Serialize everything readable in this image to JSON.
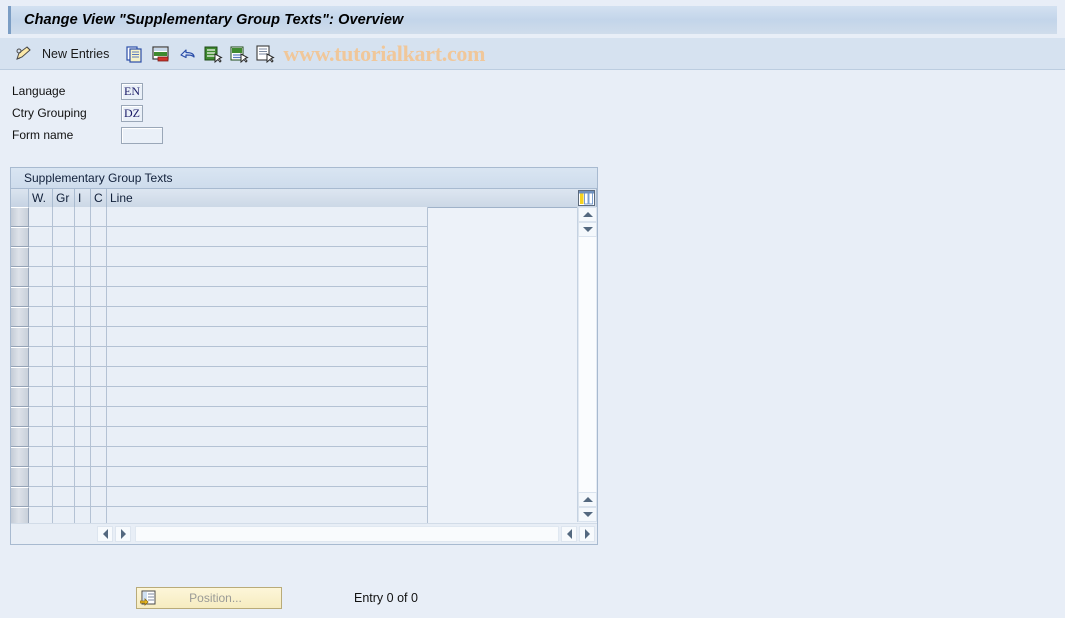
{
  "window": {
    "title": "Change View \"Supplementary Group Texts\": Overview"
  },
  "toolbar": {
    "change_icon": "pencil-icon",
    "new_entries_label": "New Entries",
    "icons": [
      {
        "name": "copy-as-icon",
        "label": "Copy As..."
      },
      {
        "name": "delete-icon",
        "label": "Delete"
      },
      {
        "name": "undo-icon",
        "label": "Undo Change"
      },
      {
        "name": "select-all-icon",
        "label": "Select All"
      },
      {
        "name": "deselect-all-icon",
        "label": "Deselect All"
      },
      {
        "name": "select-block-icon",
        "label": "Select Block"
      }
    ],
    "watermark": "www.tutorialkart.com"
  },
  "form": {
    "fields": [
      {
        "label": "Language",
        "value": "EN",
        "size": "sm",
        "name": "language-field"
      },
      {
        "label": "Ctry Grouping",
        "value": "DZ",
        "size": "sm",
        "name": "country-grouping-field"
      },
      {
        "label": "Form name",
        "value": "",
        "size": "lg",
        "name": "form-name-field"
      }
    ]
  },
  "table": {
    "caption": "Supplementary Group Texts",
    "columns": [
      {
        "key": "sel",
        "label": ""
      },
      {
        "key": "w",
        "label": "W."
      },
      {
        "key": "gr",
        "label": "Gr"
      },
      {
        "key": "i",
        "label": "I"
      },
      {
        "key": "c",
        "label": "C"
      },
      {
        "key": "line",
        "label": "Line"
      }
    ],
    "rows": [],
    "empty_row_count": 16,
    "config_icon": "table-settings-icon"
  },
  "footer": {
    "position_button_label": "Position...",
    "position_button_icon": "position-icon",
    "entry_status": "Entry 0 of 0"
  },
  "colors": {
    "background": "#e8eef7",
    "title_bar": "#cfdceb",
    "toolbar": "#d6e2f0",
    "grid_cell": "#e9eff7",
    "grid_border": "#b4c2d4",
    "watermark": "#f0c79a",
    "button_yellow": "#f6ecc0"
  }
}
